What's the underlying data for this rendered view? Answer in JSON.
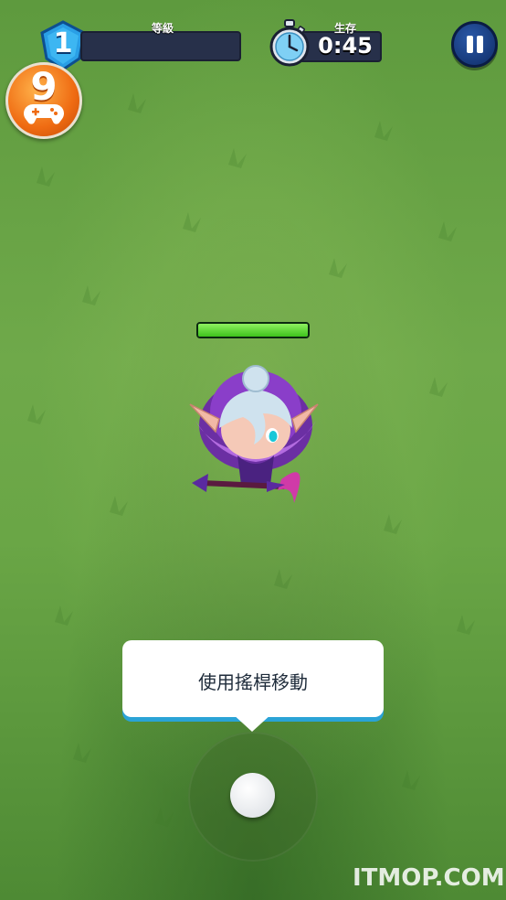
{
  "hud": {
    "level_value": "1",
    "level_label": "等級",
    "xp_progress": 0,
    "timer_label": "生存",
    "timer_value": "0:45",
    "pause_label": "pause"
  },
  "badge": {
    "value": "9"
  },
  "player": {
    "health_fraction": 1.0
  },
  "tutorial": {
    "tooltip_text": "使用搖桿移動"
  },
  "watermark": "ITMOP.COM",
  "colors": {
    "grass": "#6aa646",
    "hp_green": "#4bd12a",
    "ui_dark": "#27304a",
    "shield_blue": "#2a9fe6",
    "accent_orange": "#ef6b12",
    "tooltip_border": "#2aa3d6"
  },
  "icons": [
    "shield-level-icon",
    "stopwatch-icon",
    "pause-icon",
    "gamepad-icon"
  ]
}
